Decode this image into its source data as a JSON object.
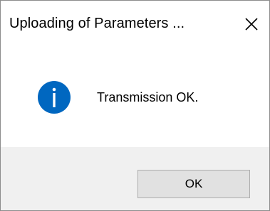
{
  "window": {
    "title": "Uploading of Parameters ...",
    "close_icon": "close-icon"
  },
  "message": {
    "icon": "info-icon",
    "icon_color": "#0067c0",
    "text": "Transmission OK."
  },
  "footer": {
    "ok_label": "OK"
  }
}
